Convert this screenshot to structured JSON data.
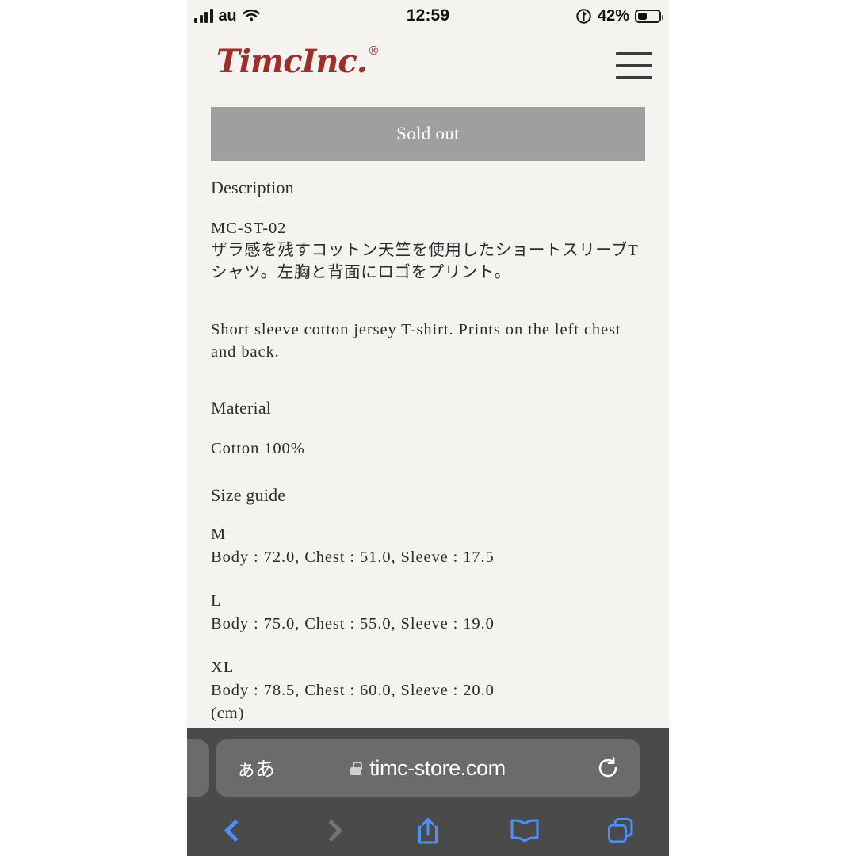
{
  "status_bar": {
    "carrier": "au",
    "time": "12:59",
    "battery_percent": "42%",
    "battery_level": 42,
    "signal_bars": 4,
    "icons": [
      "signal-bars-icon",
      "wifi-icon",
      "location-arrow-icon",
      "battery-icon"
    ]
  },
  "site_header": {
    "logo_text": "TimcInc.",
    "logo_trademark": "®",
    "logo_color": "#9e2f2c",
    "menu_icon": "hamburger-menu-icon"
  },
  "product": {
    "sold_out_label": "Sold out",
    "sold_out_bg": "#9f9f9f"
  },
  "description": {
    "heading": "Description",
    "sku": "MC-ST-02",
    "text_jp": "ザラ感を残すコットン天竺を使用したショートスリーブTシャツ。左胸と背面にロゴをプリント。",
    "text_en": "Short sleeve cotton jersey T-shirt. Prints on the left chest and back."
  },
  "material": {
    "heading": "Material",
    "value": "Cotton 100%"
  },
  "size_guide": {
    "heading": "Size guide",
    "unit": "(cm)",
    "sizes": [
      {
        "label": "M",
        "dims": "Body : 72.0, Chest : 51.0, Sleeve : 17.5"
      },
      {
        "label": "L",
        "dims": "Body : 75.0, Chest : 55.0, Sleeve : 19.0"
      },
      {
        "label": "XL",
        "dims": "Body : 78.5, Chest : 60.0, Sleeve : 20.0"
      }
    ]
  },
  "browser": {
    "text_size_label": "ぁあ",
    "lock_icon": "lock-icon",
    "url": "timc-store.com",
    "reload_icon": "reload-icon",
    "chrome_bg": "#4a4a4a",
    "accent": "#4a90ff",
    "toolbar": [
      {
        "name": "back-button",
        "icon": "chevron-left-icon",
        "enabled": true
      },
      {
        "name": "forward-button",
        "icon": "chevron-right-icon",
        "enabled": false
      },
      {
        "name": "share-button",
        "icon": "share-icon",
        "enabled": true
      },
      {
        "name": "bookmarks-button",
        "icon": "book-icon",
        "enabled": true
      },
      {
        "name": "tabs-button",
        "icon": "tabs-icon",
        "enabled": true
      }
    ]
  }
}
